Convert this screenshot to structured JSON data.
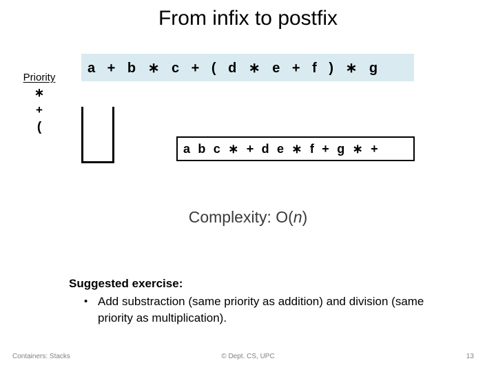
{
  "slide": {
    "title": "From infix to postfix",
    "page_number": "13"
  },
  "priority": {
    "heading": "Priority",
    "operators": [
      {
        "symbol": "∗",
        "name": "multiplication"
      },
      {
        "symbol": "+",
        "name": "addition"
      },
      {
        "symbol": "(",
        "name": "open-parenthesis"
      }
    ]
  },
  "stack": {
    "label": "",
    "contents": []
  },
  "expression": {
    "infix": "a + b ∗ c + ( d ∗ e + f ) ∗ g",
    "postfix": "a b c ∗ + d e ∗ f + g ∗ +",
    "infix_highlight_color": "#d9ebf0"
  },
  "complexity": {
    "prefix": "Complexity: O(",
    "variable": "n",
    "suffix": ")"
  },
  "exercise": {
    "heading": "Suggested exercise:",
    "bullet_glyph": "•",
    "items": [
      "Add substraction (same priority as addition) and division (same priority as multiplication)."
    ]
  },
  "footer": {
    "left": "Containers: Stacks",
    "center": "© Dept. CS, UPC",
    "right": "13"
  }
}
